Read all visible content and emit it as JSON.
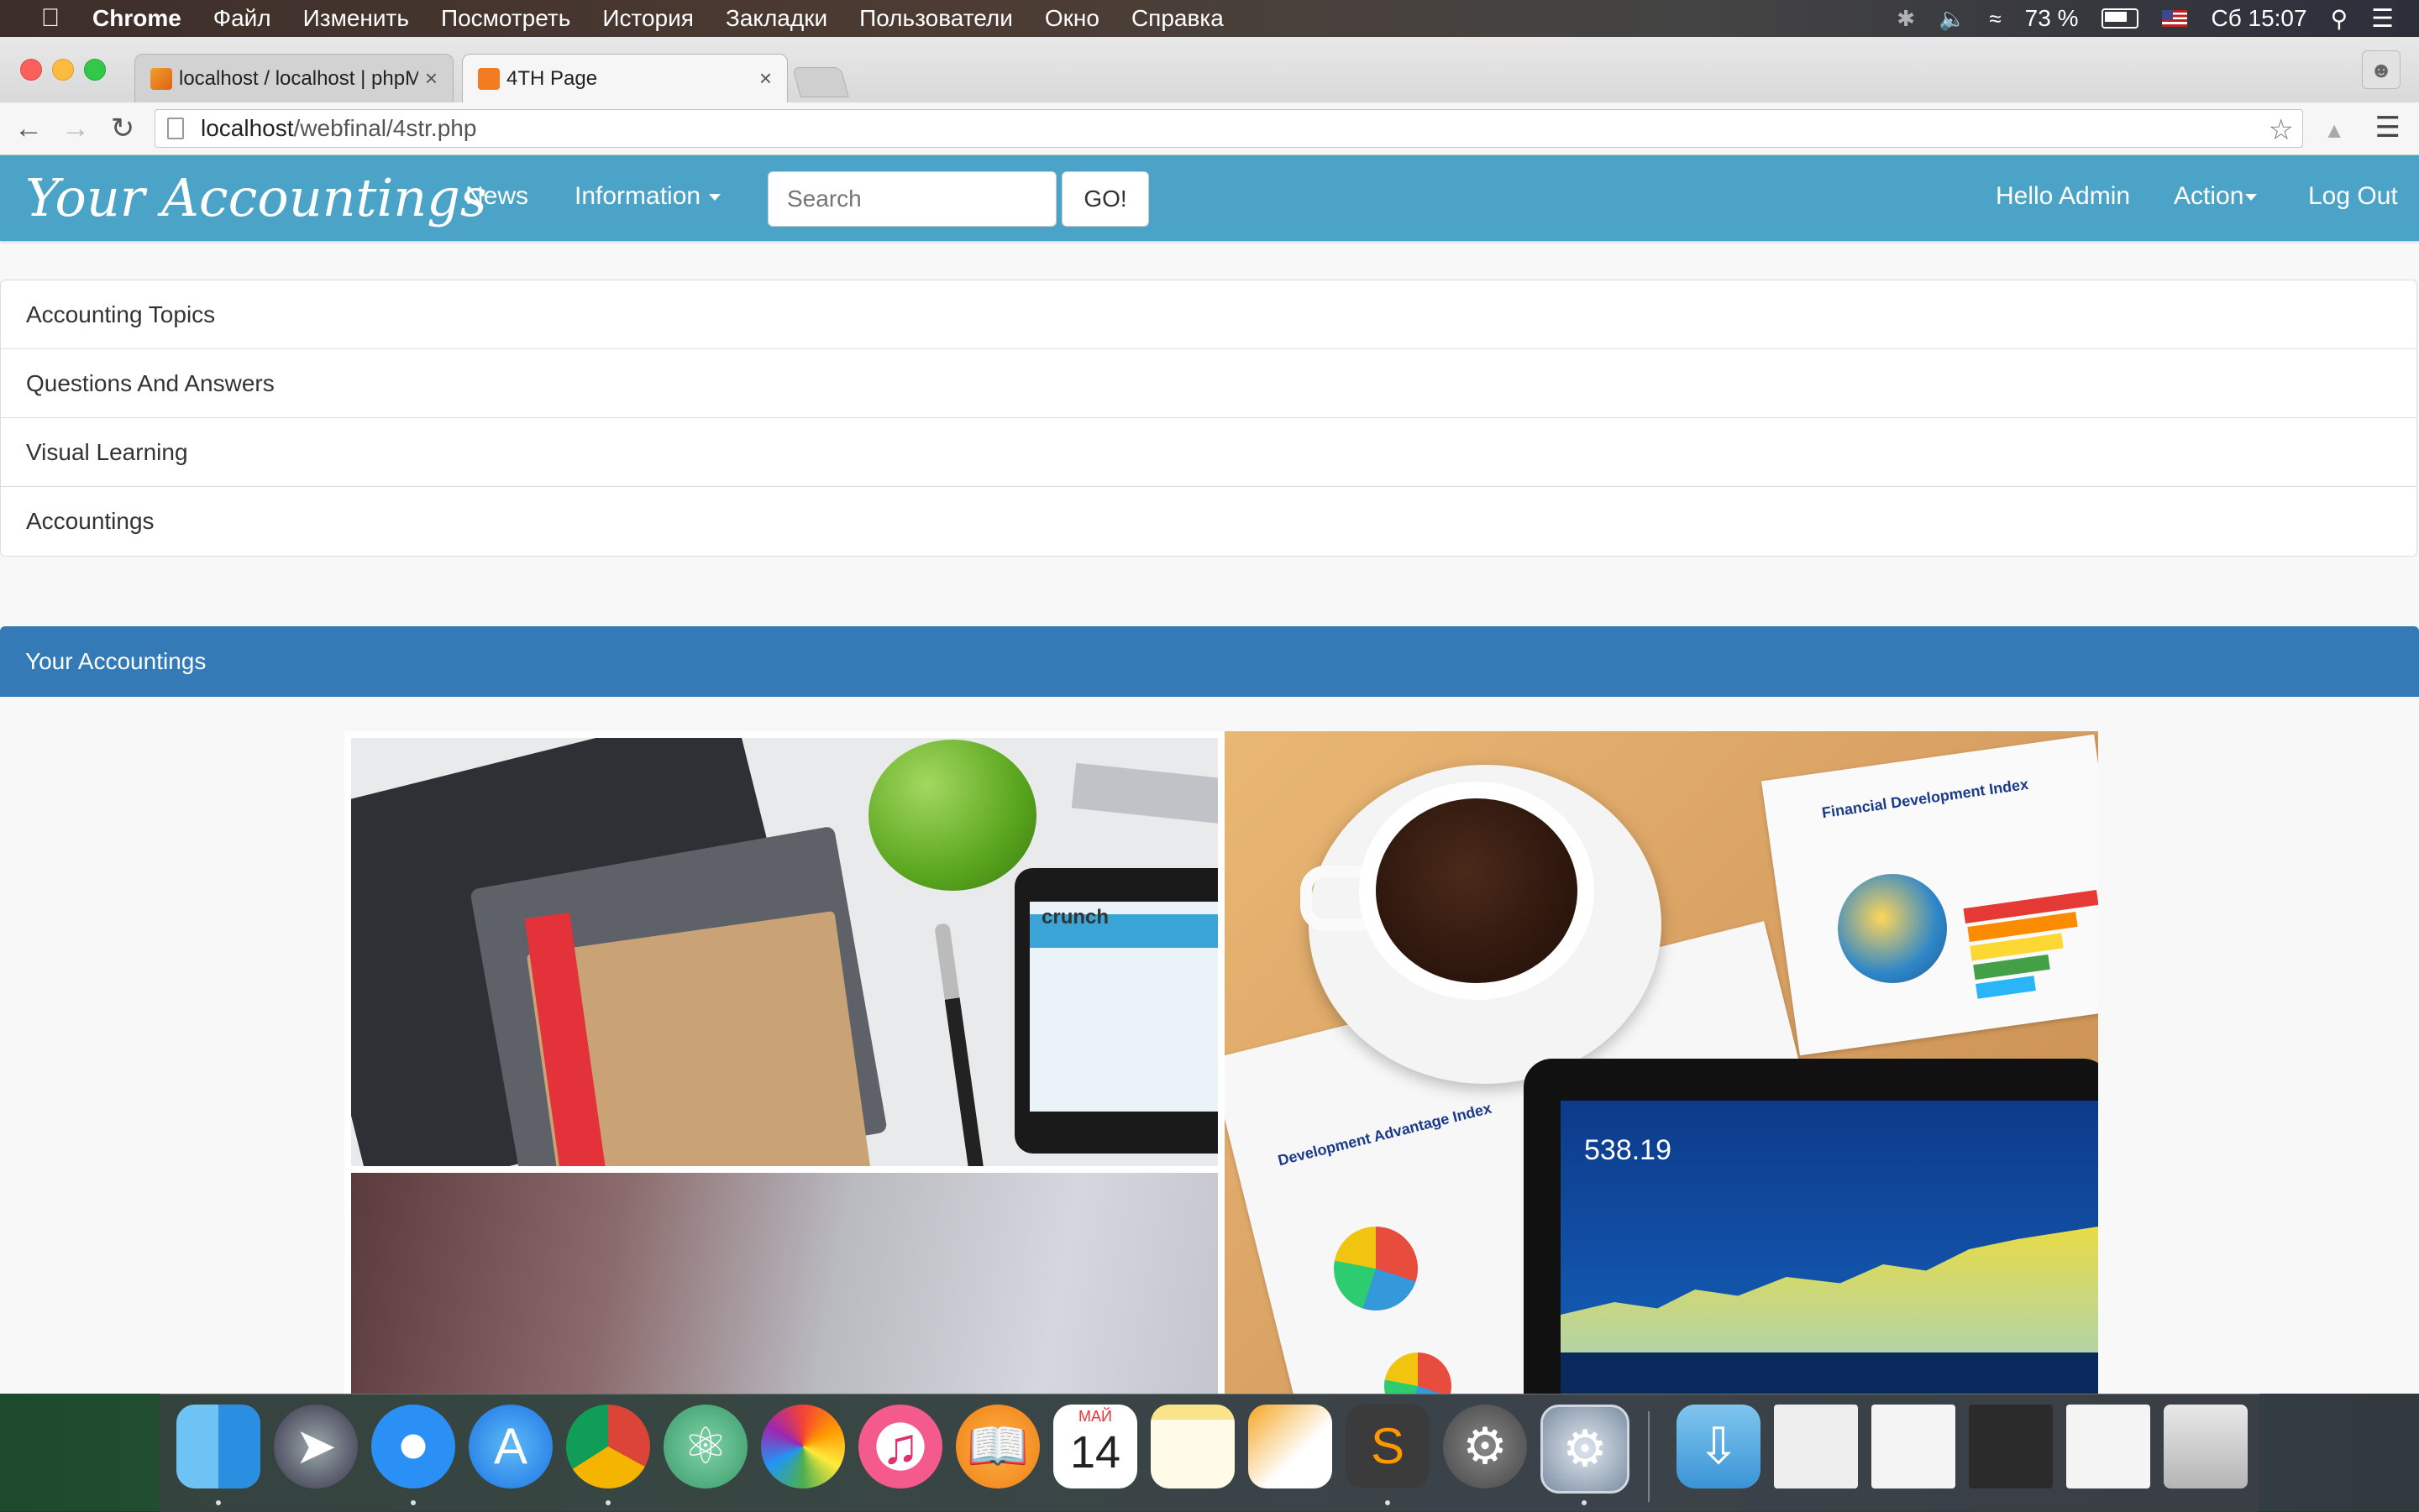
{
  "menubar": {
    "app": "Chrome",
    "items": [
      "Файл",
      "Изменить",
      "Посмотреть",
      "История",
      "Закладки",
      "Пользователи",
      "Окно",
      "Справка"
    ],
    "battery": "73 %",
    "clock": "Сб 15:07"
  },
  "browser": {
    "tabs": [
      {
        "title": "localhost / localhost | phpMyAdmin",
        "favicon": "phpmyadmin-icon",
        "active": false
      },
      {
        "title": "4TH Page",
        "favicon": "xampp-icon",
        "active": true
      }
    ],
    "url_host": "localhost",
    "url_path": "/webfinal/4str.php"
  },
  "site": {
    "brand": "Your Accountings",
    "nav": {
      "news": "News",
      "information": "Information"
    },
    "search": {
      "placeholder": "Search",
      "button": "GO!"
    },
    "right": {
      "greeting": "Hello Admin",
      "action": "Action",
      "logout": "Log Out"
    },
    "topics": [
      "Accounting Topics",
      "Questions And Answers",
      "Visual Learning",
      "Accountings"
    ],
    "panel_title": "Your Accountings",
    "collage": {
      "tablet_brand": "crunch",
      "stock_value": "538.19",
      "report_title": "Financial Development Index",
      "report_title_2": "Development Advantage Index"
    }
  },
  "dock": {
    "calendar_month": "МАЙ",
    "calendar_day": "14",
    "apps": [
      "finder",
      "launchpad",
      "safari",
      "app-store",
      "chrome",
      "atom",
      "photos",
      "itunes",
      "ibooks",
      "calendar",
      "notes",
      "pages",
      "sublime-text",
      "system-preferences",
      "system-preferences-2"
    ]
  },
  "colors": {
    "nav_bg": "#4ba3c7",
    "panel_heading": "#337ab7"
  }
}
